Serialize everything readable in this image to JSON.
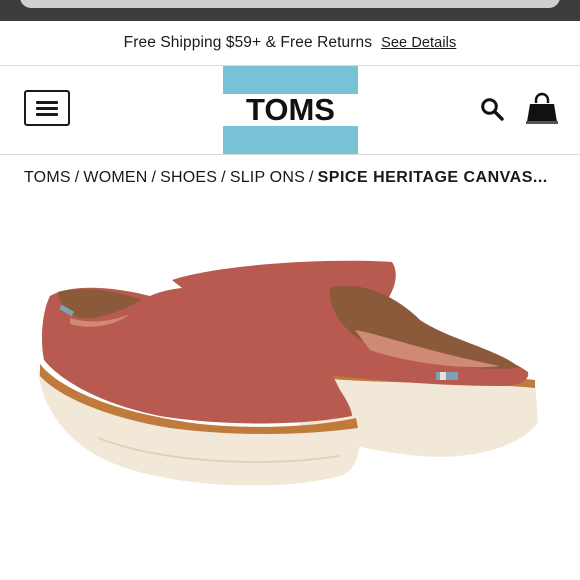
{
  "promo": {
    "text": "Free Shipping $59+ & Free Returns",
    "link": "See Details"
  },
  "header": {
    "logo_text": "TOMS",
    "menu_icon": "hamburger-menu-icon",
    "search_icon": "search-icon",
    "cart_icon": "shopping-bag-icon",
    "brand_color": "#79c2d6"
  },
  "breadcrumb": {
    "items": [
      "TOMS",
      "WOMEN",
      "SHOES",
      "SLIP ONS"
    ],
    "separator": "/",
    "current": "SPICE HERITAGE CANVAS..."
  },
  "product": {
    "image": "red-canvas-slip-on-mule-shoes",
    "shoe_color": "#b85a50"
  }
}
